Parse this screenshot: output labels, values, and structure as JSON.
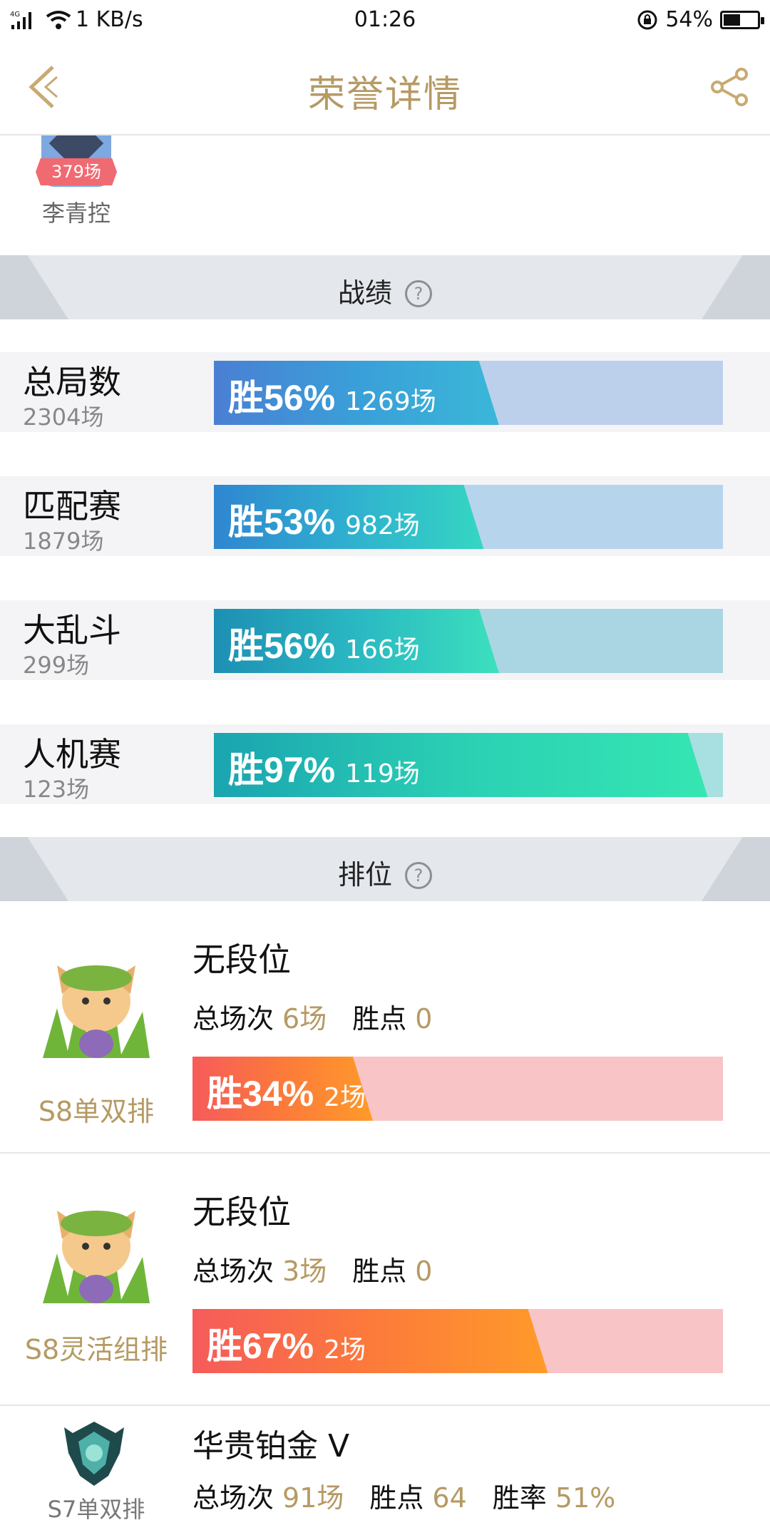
{
  "status_bar": {
    "network": "4G",
    "speed": "1 KB/s",
    "time": "01:26",
    "battery": "54%",
    "battery_level": 0.54
  },
  "header": {
    "title": "荣誉详情",
    "back_icon": "back-chevron-icon",
    "share_icon": "share-icon",
    "accent_color": "#b59a63"
  },
  "hero": {
    "count_badge": "379场",
    "name": "李青控"
  },
  "stats_section": {
    "title": "战绩",
    "help_icon": "?"
  },
  "stats": [
    {
      "name": "总局数",
      "total": "2304场",
      "win_label": "胜56%",
      "games": "1269场",
      "win_rate": 0.56
    },
    {
      "name": "匹配赛",
      "total": "1879场",
      "win_label": "胜53%",
      "games": "982场",
      "win_rate": 0.53
    },
    {
      "name": "大乱斗",
      "total": "299场",
      "win_label": "胜56%",
      "games": "166场",
      "win_rate": 0.56
    },
    {
      "name": "人机赛",
      "total": "123场",
      "win_label": "胜97%",
      "games": "119场",
      "win_rate": 0.97
    }
  ],
  "ranked_section": {
    "title": "排位",
    "help_icon": "?"
  },
  "ranked": [
    {
      "queue": "S8单双排",
      "tier": "无段位",
      "matches_label": "总场次",
      "matches": "6场",
      "points_label": "胜点",
      "points": "0",
      "win_label": "胜34%",
      "games": "2场",
      "win_rate": 0.34
    },
    {
      "queue": "S8灵活组排",
      "tier": "无段位",
      "matches_label": "总场次",
      "matches": "3场",
      "points_label": "胜点",
      "points": "0",
      "win_label": "胜67%",
      "games": "2场",
      "win_rate": 0.67
    },
    {
      "queue": "S7单双排",
      "tier": "华贵铂金 V",
      "matches_label": "总场次",
      "matches": "91场",
      "points_label": "胜点",
      "points": "64",
      "rate_label": "胜率",
      "rate": "51%"
    }
  ]
}
